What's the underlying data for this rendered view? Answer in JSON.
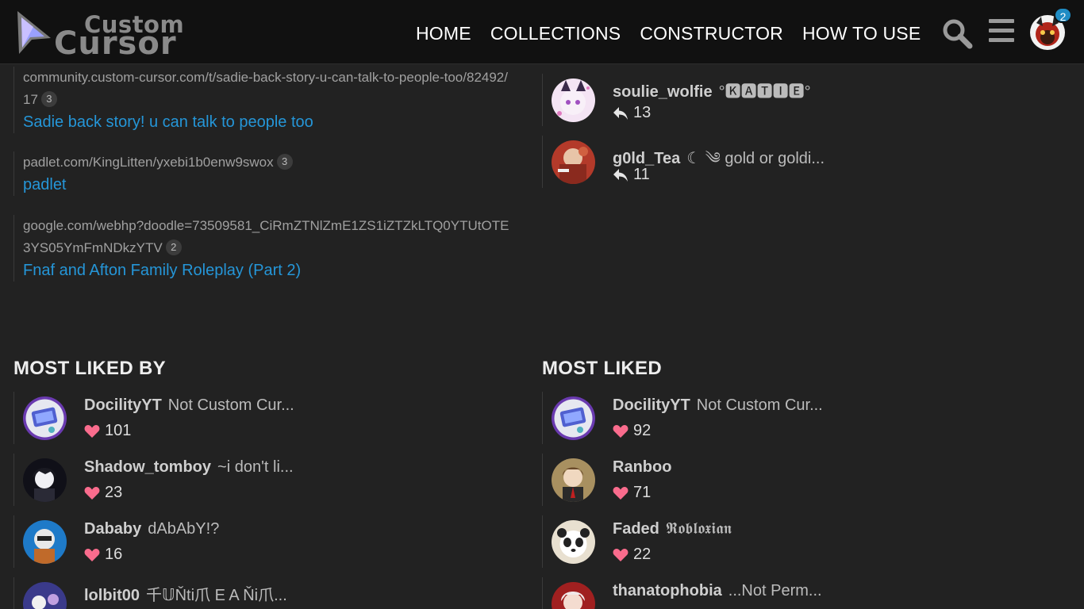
{
  "header": {
    "logo_line1": "Custom",
    "logo_line2": "Cursor",
    "nav": [
      "HOME",
      "COLLECTIONS",
      "CONSTRUCTOR",
      "HOW TO USE"
    ],
    "notification_count": "2"
  },
  "links": [
    {
      "url": "community.custom-cursor.com/t/sadie-back-story-u-can-talk-to-people-too/82492/17",
      "count": "3",
      "title": "Sadie back story! u can talk to people too"
    },
    {
      "url": "padlet.com/KingLitten/yxebi1b0enw9swox",
      "count": "3",
      "title": "padlet"
    },
    {
      "url": "google.com/webhp?doodle=73509581_CiRmZTNlZmE1ZS1iZTZkLTQ0YTUtOTE3YS05YmFmNDkzYTV",
      "count": "2",
      "title": "Fnaf and Afton Family Roleplay (Part 2)"
    }
  ],
  "top_replies": [
    {
      "name": "soulie_wolfie",
      "title": "°🅺🅰🆃🅸🅴°",
      "count": "13"
    },
    {
      "name": "g0ld_Tea",
      "title": "☾ ༄ gold or goldi...",
      "count": "11"
    }
  ],
  "most_liked_by": {
    "heading": "MOST LIKED BY",
    "users": [
      {
        "name": "DocilityYT",
        "title": "Not Custom Cur...",
        "count": "101"
      },
      {
        "name": "Shadow_tomboy",
        "title": "~i don't li...",
        "count": "23"
      },
      {
        "name": "Dababy",
        "title": "dAbAbY!?",
        "count": "16"
      },
      {
        "name": "lolbit00",
        "title": "千𝕌Ňti爪 E  A Ňi爪...",
        "count": ""
      }
    ]
  },
  "most_liked": {
    "heading": "MOST LIKED",
    "users": [
      {
        "name": "DocilityYT",
        "title": "Not Custom Cur...",
        "count": "92"
      },
      {
        "name": "Ranboo",
        "title": "",
        "count": "71"
      },
      {
        "name": "Faded",
        "title": "𝕽𝖔𝖇𝖑𝖔𝖝𝖎𝖆𝖓",
        "count": "22"
      },
      {
        "name": "thanatophobia",
        "title": "...Not Perm...",
        "count": ""
      }
    ]
  },
  "colors": {
    "background": "#222222",
    "header": "#111111",
    "link": "#2596d8",
    "heart": "#fa6c8d",
    "badge": "#1f8cc4"
  }
}
